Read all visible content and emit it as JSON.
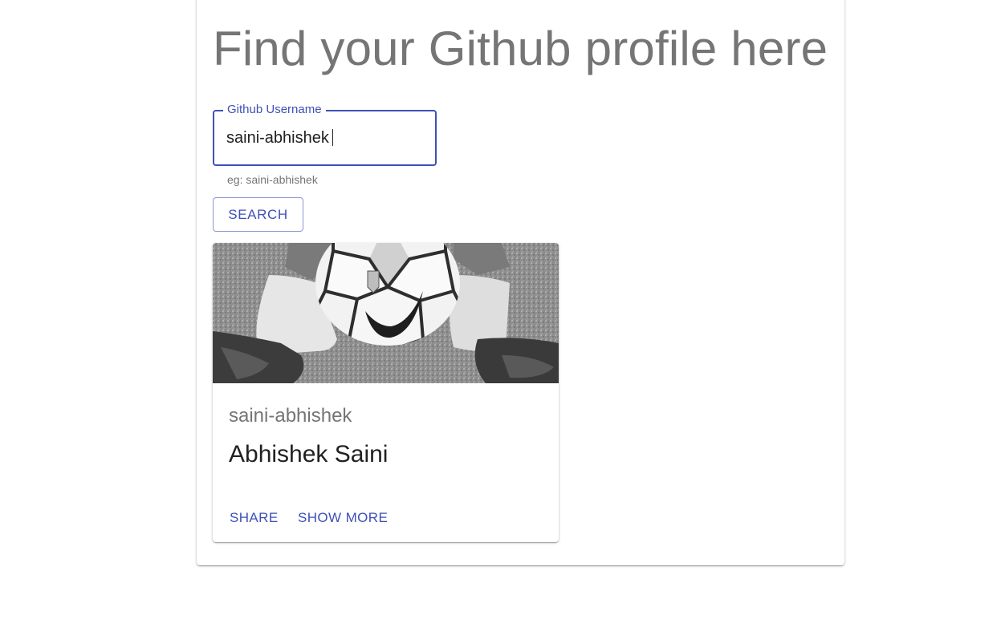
{
  "header": {
    "title": "Find your Github profile here"
  },
  "search": {
    "label": "Github Username",
    "value": "saini-abhishek",
    "helper_text": "eg: saini-abhishek",
    "button_label": "SEARCH"
  },
  "profile_card": {
    "image_alt": "avatar",
    "username": "saini-abhishek",
    "name": "Abhishek Saini",
    "actions": {
      "share_label": "SHARE",
      "show_more_label": "SHOW MORE"
    }
  },
  "colors": {
    "primary": "#3f51b5",
    "text_secondary": "#757575",
    "text_primary": "#212121"
  }
}
